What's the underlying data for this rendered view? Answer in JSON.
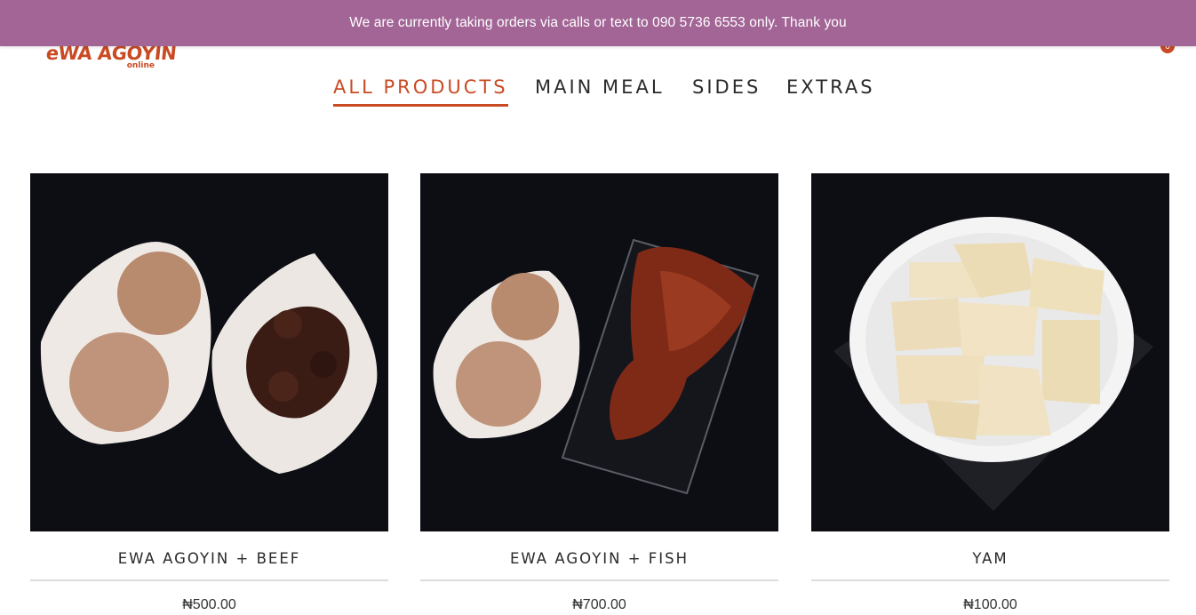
{
  "notice": {
    "text": "We are currently taking orders via calls or text to 090 5736 6553 only. Thank you"
  },
  "header": {
    "logo_text": "eWA AGOYIN",
    "logo_sub": "online",
    "cart_count": "0"
  },
  "filters": [
    {
      "label": "ALL PRODUCTS",
      "active": true
    },
    {
      "label": "MAIN MEAL",
      "active": false
    },
    {
      "label": "SIDES",
      "active": false
    },
    {
      "label": "EXTRAS",
      "active": false
    }
  ],
  "products": [
    {
      "name": "EWA AGOYIN + BEEF",
      "price": "₦500.00",
      "image": "beans-and-beef-photo"
    },
    {
      "name": "EWA AGOYIN + FISH",
      "price": "₦700.00",
      "image": "beans-and-fish-photo"
    },
    {
      "name": "YAM",
      "price": "₦100.00",
      "image": "boiled-yam-photo"
    }
  ],
  "colors": {
    "accent": "#c94a23",
    "notice_bg": "#a26596",
    "image_bg": "#0c0e14"
  }
}
